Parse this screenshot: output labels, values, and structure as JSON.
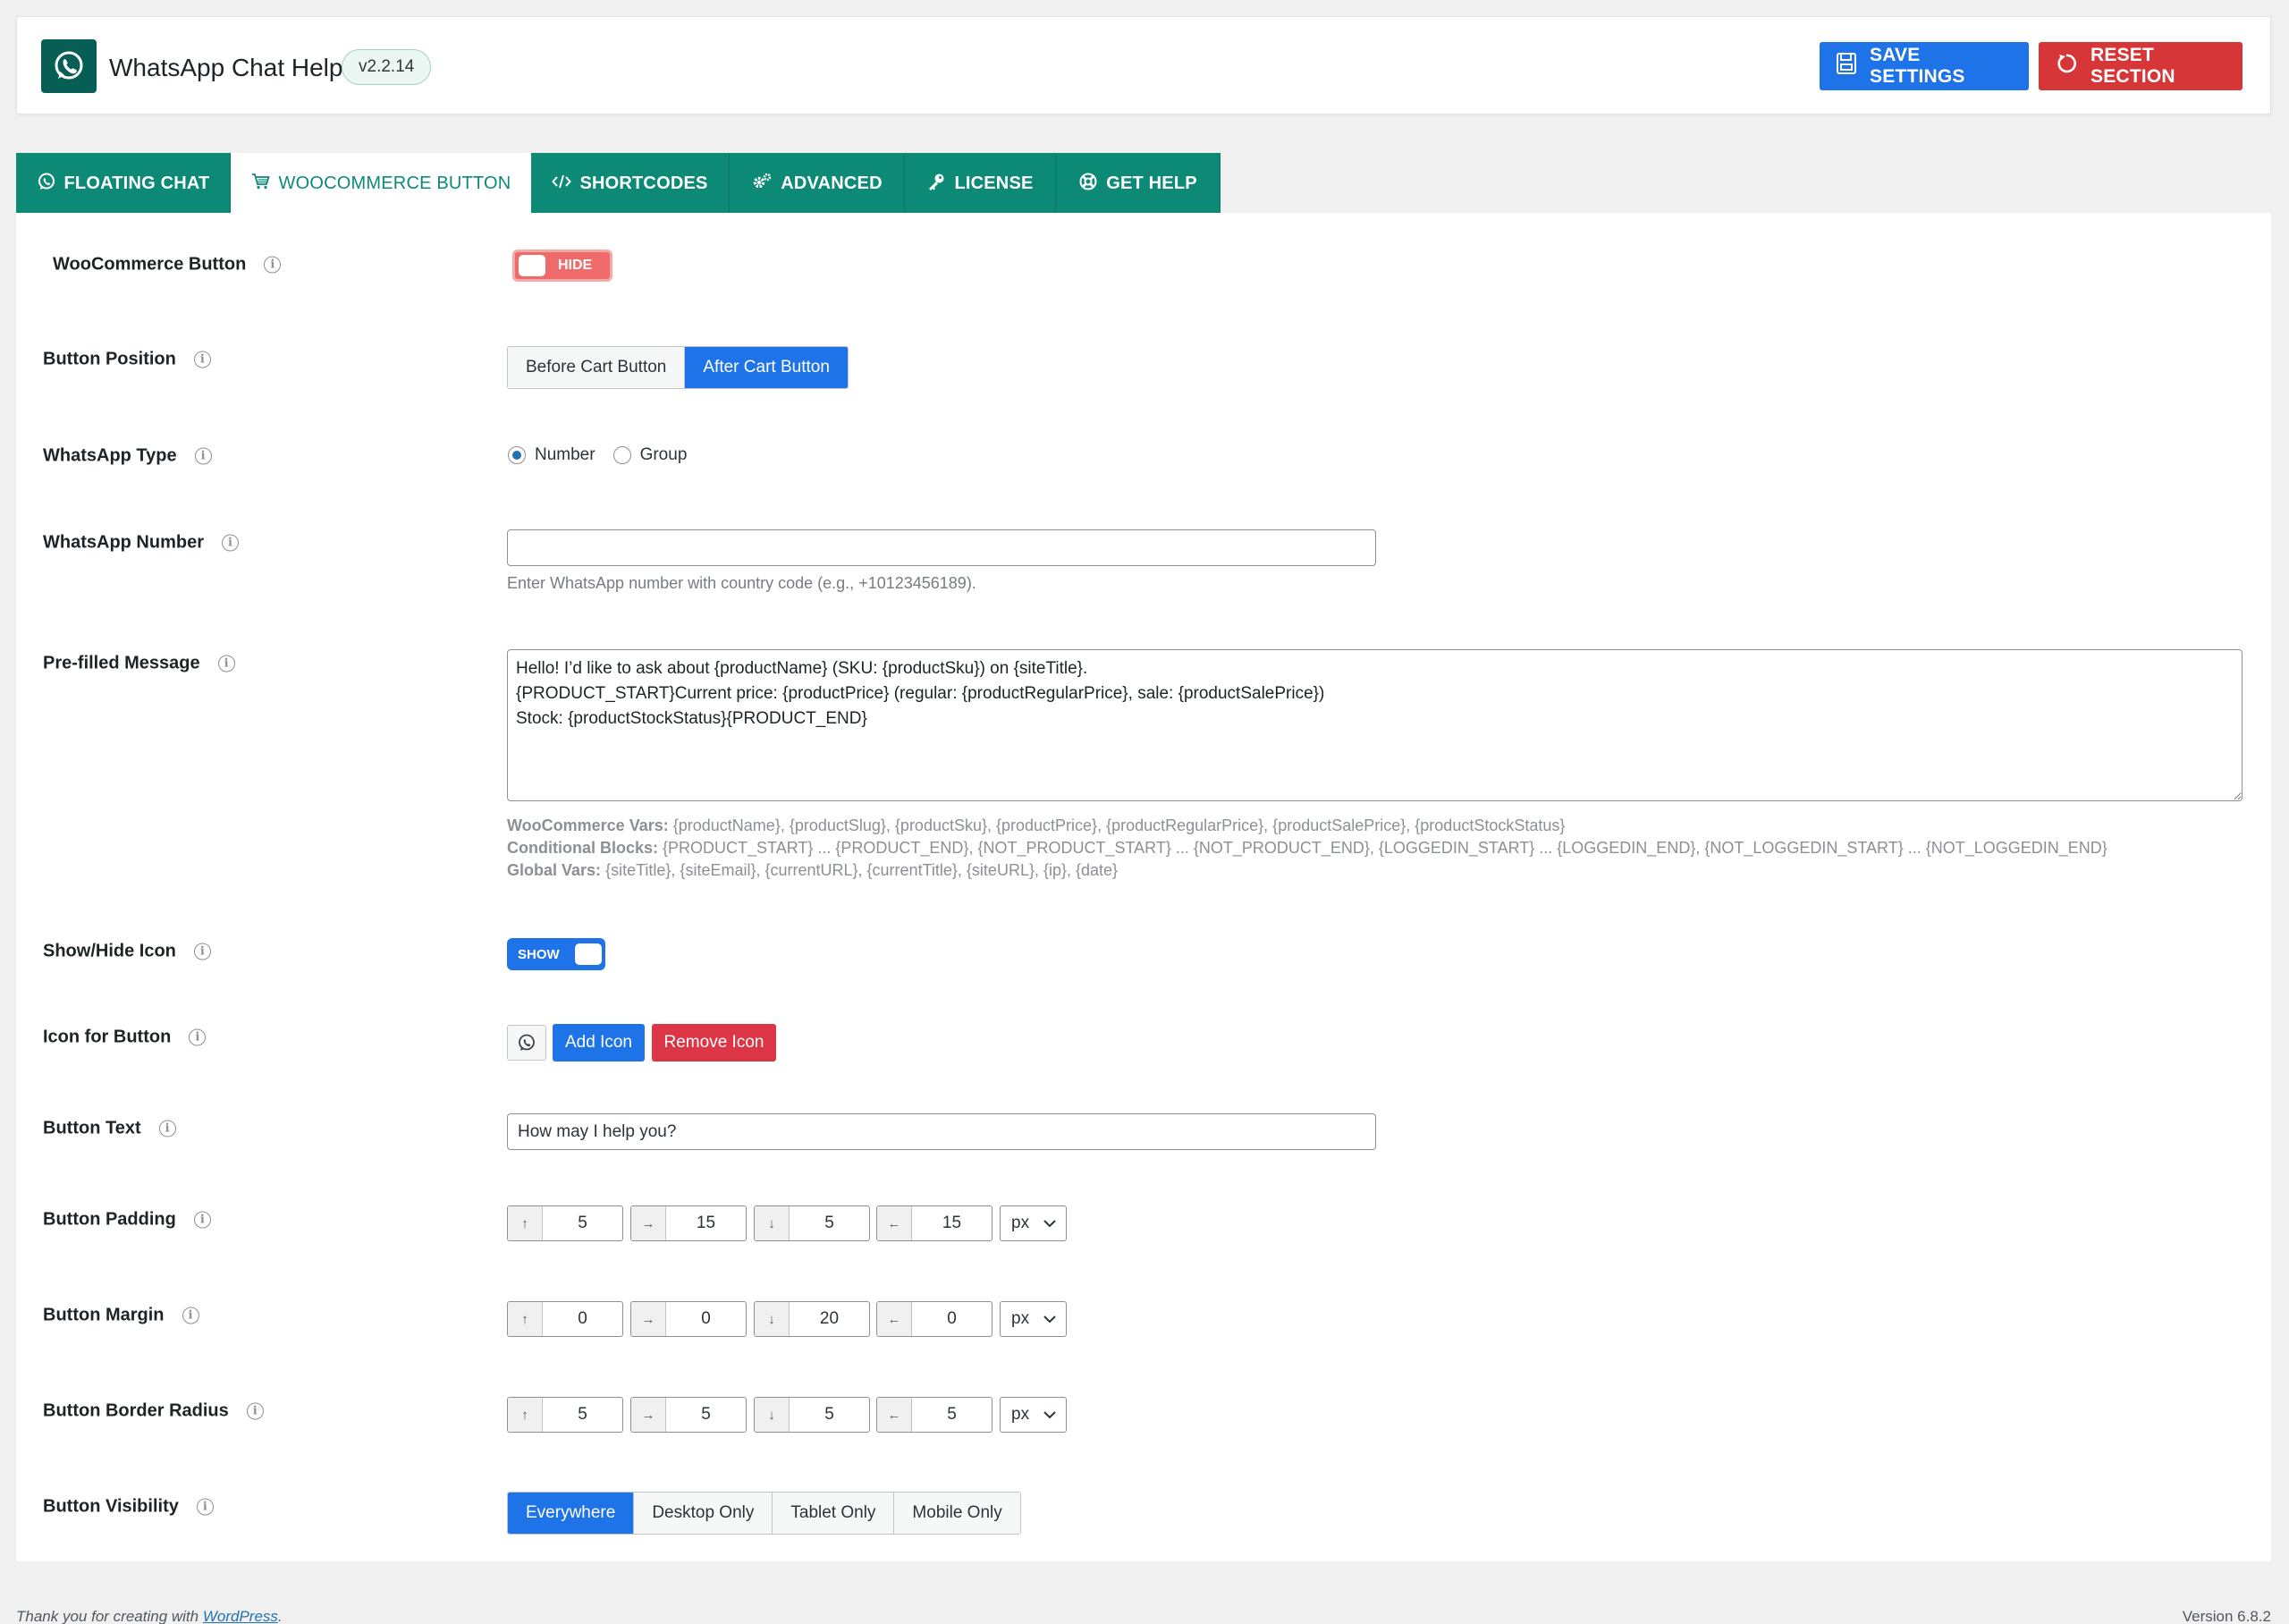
{
  "header": {
    "title": "WhatsApp Chat Help",
    "version": "v2.2.14",
    "save_label": "SAVE SETTINGS",
    "reset_label": "RESET SECTION",
    "brand_color": "#075e54",
    "save_color": "#1f73e8",
    "reset_color": "#d63638"
  },
  "tabs": [
    {
      "label": "FLOATING CHAT",
      "icon": "whatsapp-icon"
    },
    {
      "label": "WOOCOMMERCE BUTTON",
      "icon": "cart-icon",
      "active": true
    },
    {
      "label": "SHORTCODES",
      "icon": "code-icon"
    },
    {
      "label": "ADVANCED",
      "icon": "gears-icon"
    },
    {
      "label": "LICENSE",
      "icon": "key-icon"
    },
    {
      "label": "GET HELP",
      "icon": "lifebuoy-icon"
    }
  ],
  "fields": {
    "woo_button": {
      "label": "WooCommerce Button",
      "toggle": "HIDE"
    },
    "position": {
      "label": "Button Position",
      "options": [
        "Before Cart Button",
        "After Cart Button"
      ],
      "selected": "After Cart Button"
    },
    "wa_type": {
      "label": "WhatsApp Type",
      "options": [
        "Number",
        "Group"
      ],
      "selected": "Number"
    },
    "wa_number": {
      "label": "WhatsApp Number",
      "value": "",
      "help": "Enter WhatsApp number with country code (e.g., +10123456189)."
    },
    "message": {
      "label": "Pre-filled Message",
      "value": "Hello! I’d like to ask about {productName} (SKU: {productSku}) on {siteTitle}.\n{PRODUCT_START}Current price: {productPrice} (regular: {productRegularPrice}, sale: {productSalePrice})\nStock: {productStockStatus}{PRODUCT_END}",
      "vars_woo_label": "WooCommerce Vars:",
      "vars_woo": "{productName}, {productSlug}, {productSku}, {productPrice}, {productRegularPrice}, {productSalePrice}, {productStockStatus}",
      "vars_cond_label": "Conditional Blocks:",
      "vars_cond": "{PRODUCT_START} ... {PRODUCT_END}, {NOT_PRODUCT_START} ... {NOT_PRODUCT_END}, {LOGGEDIN_START} ... {LOGGEDIN_END}, {NOT_LOGGEDIN_START} ... {NOT_LOGGEDIN_END}",
      "vars_global_label": "Global Vars:",
      "vars_global": "{siteTitle}, {siteEmail}, {currentURL}, {currentTitle}, {siteURL}, {ip}, {date}"
    },
    "show_icon": {
      "label": "Show/Hide Icon",
      "toggle": "SHOW"
    },
    "icon": {
      "label": "Icon for Button",
      "add_label": "Add Icon",
      "remove_label": "Remove Icon"
    },
    "button_text": {
      "label": "Button Text",
      "value": "How may I help you?"
    },
    "padding": {
      "label": "Button Padding",
      "values": [
        "5",
        "15",
        "5",
        "15"
      ],
      "unit": "px"
    },
    "margin": {
      "label": "Button Margin",
      "values": [
        "0",
        "0",
        "20",
        "0"
      ],
      "unit": "px"
    },
    "radius": {
      "label": "Button Border Radius",
      "values": [
        "5",
        "5",
        "5",
        "5"
      ],
      "unit": "px"
    },
    "visibility": {
      "label": "Button Visibility",
      "options": [
        "Everywhere",
        "Desktop Only",
        "Tablet Only",
        "Mobile Only"
      ],
      "selected": "Everywhere"
    }
  },
  "arrows": [
    "↑",
    "→",
    "↓",
    "←"
  ],
  "footer": {
    "text": "Thank you for creating with",
    "link": "WordPress",
    "version": "Version 6.8.2"
  }
}
